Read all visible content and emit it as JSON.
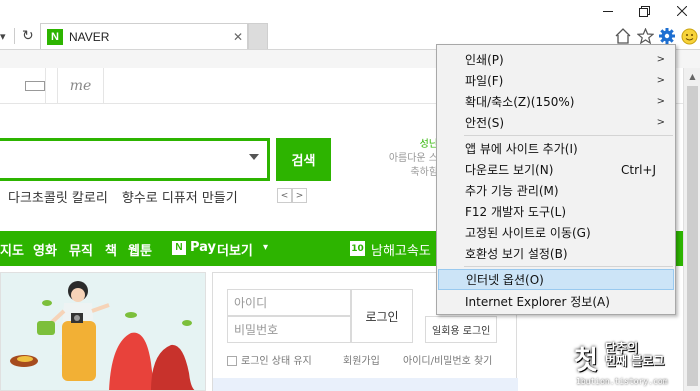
{
  "browser": {
    "tab": {
      "favicon_letter": "N",
      "title": "NAVER",
      "close_glyph": "✕"
    },
    "nav": {
      "dropdown_glyph": "▾",
      "refresh_glyph": "↻"
    },
    "window_controls": [
      "minimize",
      "restore",
      "close"
    ],
    "toolbar_icons": [
      "home-icon",
      "favorites-star-icon",
      "tools-gear-icon",
      "feedback-smiley-icon"
    ]
  },
  "page": {
    "services": [
      "",
      "me"
    ],
    "search": {
      "button": "검색"
    },
    "aside_ad": [
      "성닌",
      "아름다운 스",
      "축하힘"
    ],
    "hot_keywords": [
      "다크초콜릿 칼로리",
      "향수로 디퓨저 만들기"
    ],
    "pager": [
      "<",
      ">"
    ],
    "gnb": [
      "지도",
      "영화",
      "뮤직",
      "책",
      "웹툰"
    ],
    "npay": {
      "badge": "N",
      "label": "Pay"
    },
    "more": "더보기",
    "rank": {
      "number": "10",
      "text": "남해고속도"
    },
    "login": {
      "id_placeholder": "아이디",
      "pw_placeholder": "비밀번호",
      "button": "로그인",
      "keep_login": "로그인 상태 유지",
      "signup": "회원가입",
      "find": "아이디/비밀번호 찾기",
      "onetime": "일회용 로그인"
    }
  },
  "menu": {
    "items": [
      {
        "label": "인쇄(P)",
        "submenu": true
      },
      {
        "label": "파일(F)",
        "submenu": true
      },
      {
        "label": "확대/축소(Z)(150%)",
        "submenu": true
      },
      {
        "label": "안전(S)",
        "submenu": true
      },
      {
        "label": "앱 뷰에 사이트 추가(I)"
      },
      {
        "label": "다운로드 보기(N)",
        "shortcut": "Ctrl+J"
      },
      {
        "label": "추가 기능 관리(M)"
      },
      {
        "label": "F12 개발자 도구(L)"
      },
      {
        "label": "고정된 사이트로 이동(G)"
      },
      {
        "label": "호환성 보기 설정(B)"
      },
      {
        "label": "인터넷 옵션(O)",
        "highlighted": true
      },
      {
        "label": "Internet Explorer 정보(A)"
      }
    ],
    "submenu_glyph": ">"
  },
  "watermark": {
    "big": "첫",
    "line1": "단추의",
    "line2": "번째 블로그",
    "url": "1bution.tistory.com"
  },
  "colors": {
    "naver_green": "#2db400",
    "menu_bg": "#f2f2f2",
    "menu_highlight": "#cce4f7"
  }
}
